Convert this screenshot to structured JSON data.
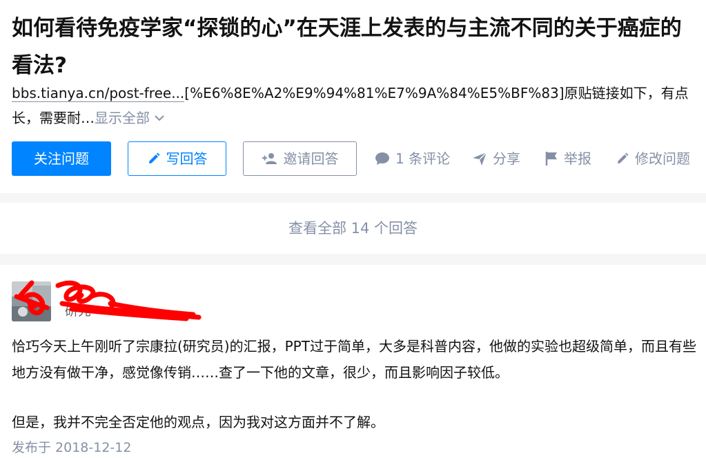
{
  "question": {
    "title": "如何看待免疫学家“探锁的心”在天涯上发表的与主流不同的关于癌症的看法?",
    "detail_link": "bbs.tianya.cn/post-free...",
    "detail_text": "[%E6%8E%A2%E9%94%81%E7%9A%84%E5%BF%83]原贴链接如下，有点长，需要耐…",
    "show_all": "显示全部"
  },
  "actions": {
    "follow": "关注问题",
    "write": "写回答",
    "invite": "邀请回答",
    "comments": "1 条评论",
    "share": "分享",
    "report": "举报",
    "edit": "修改问题"
  },
  "view_all": "查看全部 14 个回答",
  "answer": {
    "author_partial": "研先",
    "paragraphs": [
      "恰巧今天上午刚听了宗康拉(研究员)的汇报，PPT过于简单，大多是科普内容，他做的实验也超级简单，而且有些地方没有做干净，感觉像传销……查了一下他的文章，很少，而且影响因子较低。",
      "但是，我并不完全否定他的观点，因为我对这方面并不了解。"
    ],
    "published": "发布于 2018-12-12"
  },
  "colors": {
    "primary": "#0084ff",
    "muted": "#8590a6",
    "text": "#121212",
    "redaction": "#ff0000"
  }
}
